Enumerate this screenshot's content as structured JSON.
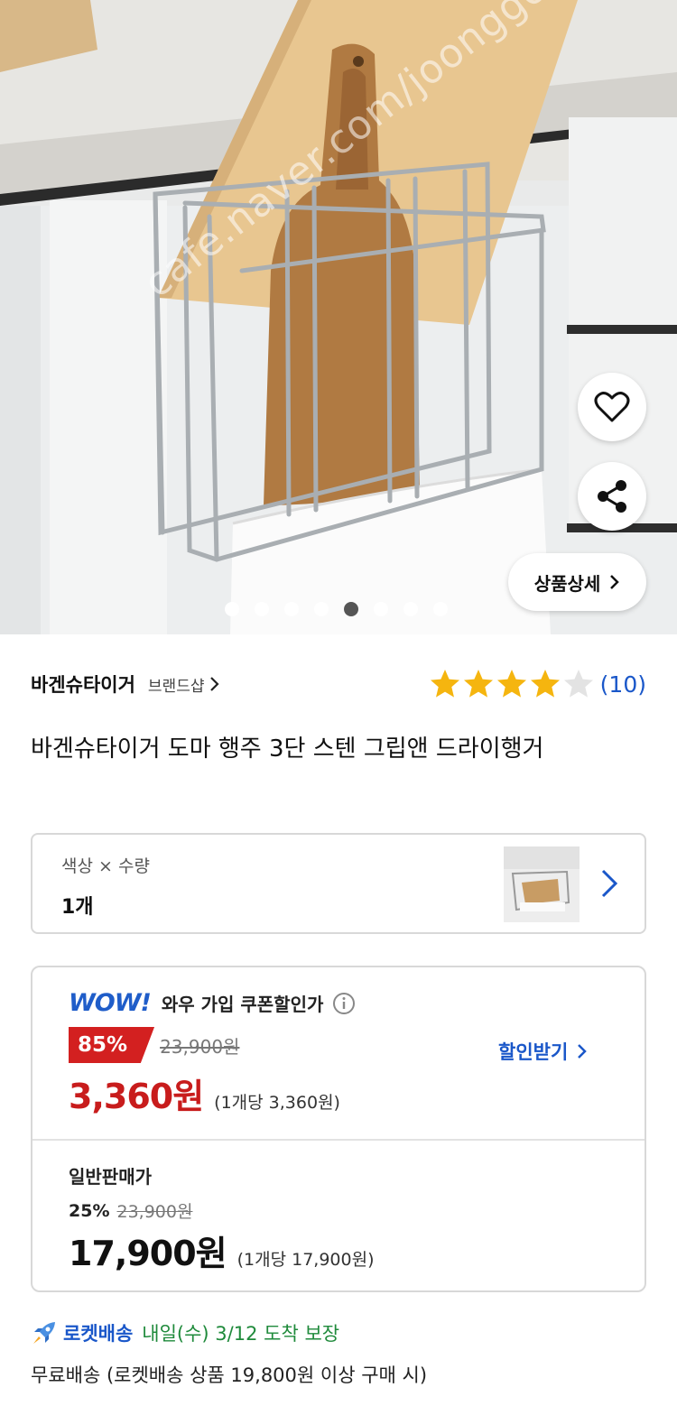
{
  "hero": {
    "watermark": "cafe.naver.com/joonggonara",
    "pager": {
      "count": 8,
      "active_index": 4
    },
    "detail_button_label": "상품상세"
  },
  "brand": {
    "name": "바겐슈타이거",
    "shop_link": "브랜드샵"
  },
  "rating": {
    "stars": 4,
    "max_stars": 5,
    "review_count": "(10)",
    "star_color": "#f5b50f",
    "empty_star_color": "#e3e3e3"
  },
  "product": {
    "title": "바겐슈타이거 도마 행주 3단 스텐 그립앤 드라이행거"
  },
  "option": {
    "label": "색상 × 수량",
    "value": "1개"
  },
  "wow_price": {
    "logo": "WOW!",
    "label": "와우 가입 쿠폰할인가",
    "discount_rate": "85%",
    "original_price": "23,900원",
    "price": "3,360원",
    "unit_price": "(1개당 3,360원)",
    "get_discount_label": "할인받기"
  },
  "normal_price": {
    "label": "일반판매가",
    "discount_rate": "25%",
    "original_price": "23,900원",
    "price": "17,900원",
    "unit_price": "(1개당 17,900원)"
  },
  "delivery": {
    "rocket_label": "로켓배송",
    "arrival": "내일(수) 3/12 도착 보장",
    "free_shipping": "무료배송 (로켓배송 상품 19,800원 이상 구매 시)"
  },
  "colors": {
    "accent_blue": "#1a57c9",
    "sale_red": "#c81c1c",
    "arrival_green": "#1f8a3b"
  }
}
